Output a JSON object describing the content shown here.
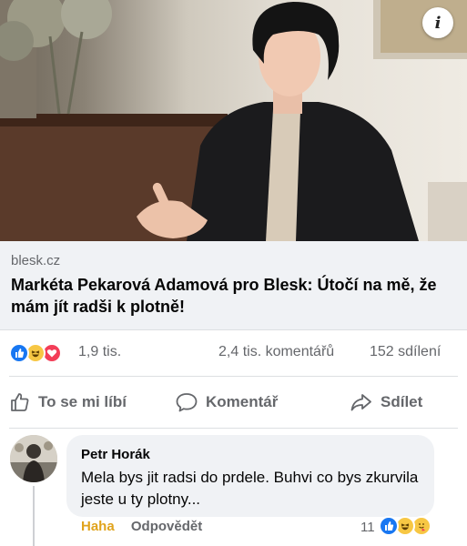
{
  "post": {
    "info_icon_glyph": "i",
    "link": {
      "domain": "blesk.cz",
      "title": "Markéta Pekarová Adamová pro Blesk: Útočí na mě, že mám jít radši k plotně!"
    },
    "stats": {
      "reactions_count": "1,9 tis.",
      "comments": "2,4 tis. komentářů",
      "shares": "152 sdílení",
      "reaction_icons": [
        "like-icon",
        "haha-icon",
        "love-icon"
      ]
    },
    "actions": {
      "like_label": "To se mi líbí",
      "comment_label": "Komentář",
      "share_label": "Sdílet"
    }
  },
  "comment": {
    "author": "Petr Horák",
    "text": "Mela bys jit radsi do prdele. Buhvi co bys zkurvila jeste u ty plotny...",
    "haha_label": "Haha",
    "reply_label": "Odpovědět",
    "reaction_count": "11",
    "reaction_icons": [
      "like-icon",
      "haha-icon",
      "care-icon"
    ]
  },
  "colors": {
    "brand_blue": "#1877f2",
    "haha_yellow": "#f7c744",
    "love_red": "#f33e58",
    "secondary_text": "#65676b",
    "bubble_bg": "#f0f2f5"
  }
}
